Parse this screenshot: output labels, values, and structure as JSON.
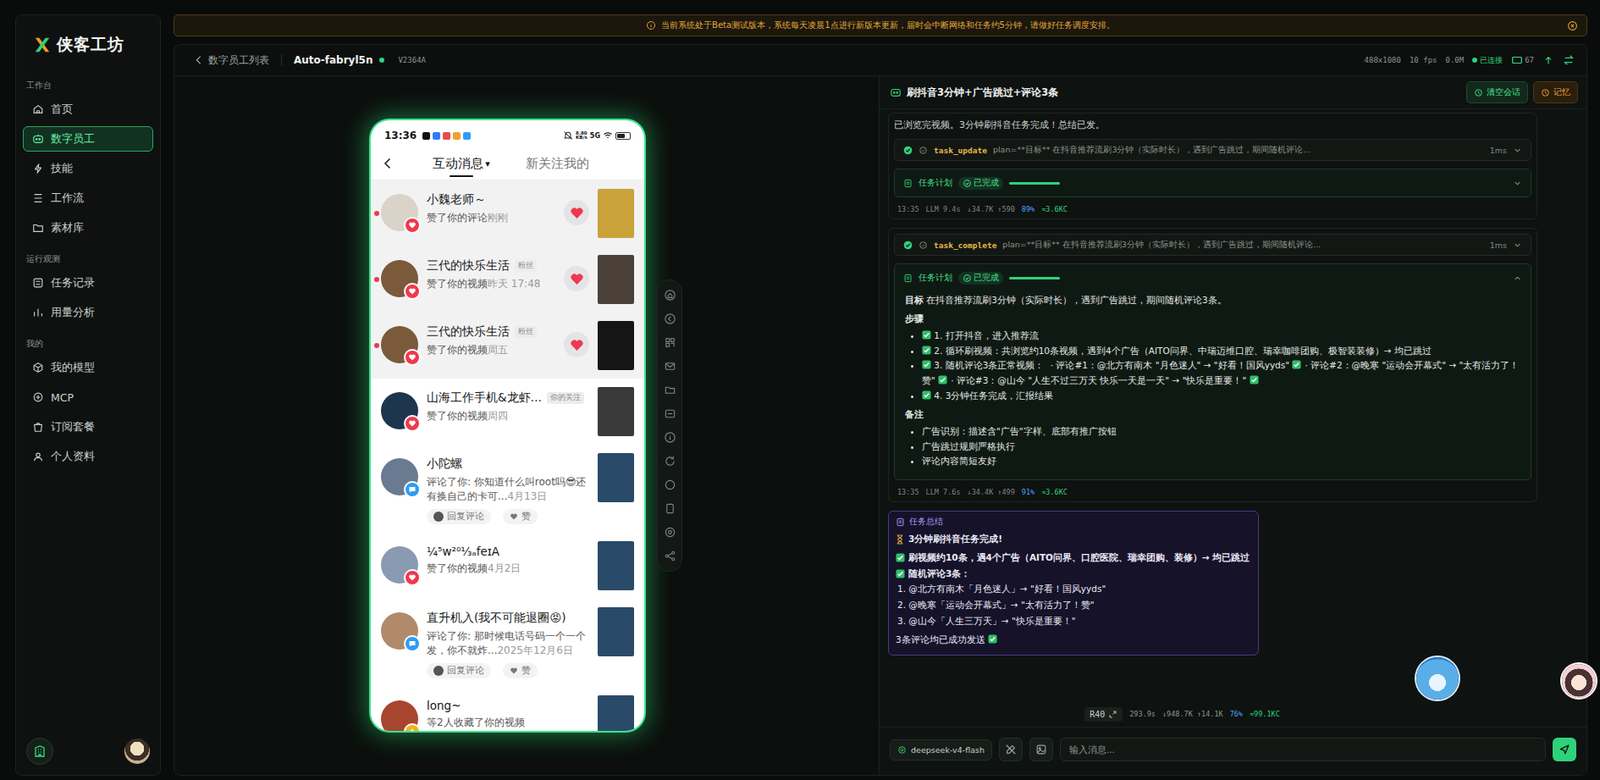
{
  "sidebar": {
    "logo": "侠客工坊",
    "sections": [
      {
        "title": "工作台",
        "items": [
          {
            "label": "首页",
            "selected": false
          },
          {
            "label": "数字员工",
            "selected": true
          },
          {
            "label": "技能",
            "selected": false
          },
          {
            "label": "工作流",
            "selected": false
          },
          {
            "label": "素材库",
            "selected": false
          }
        ]
      },
      {
        "title": "运行观测",
        "items": [
          {
            "label": "任务记录",
            "selected": false
          },
          {
            "label": "用量分析",
            "selected": false
          }
        ]
      },
      {
        "title": "我的",
        "items": [
          {
            "label": "我的模型",
            "selected": false
          },
          {
            "label": "MCP",
            "selected": false
          },
          {
            "label": "订阅套餐",
            "selected": false
          },
          {
            "label": "个人资料",
            "selected": false
          }
        ]
      }
    ]
  },
  "banner": {
    "text": "当前系统处于Beta测试版本，系统每天凌晨1点进行新版本更新，届时会中断网络和任务约5分钟，请做好任务调度安排。"
  },
  "header": {
    "back": "数字员工列表",
    "name": "Auto-fabryl5n",
    "online": true,
    "version": "V2364A",
    "resolution": "488x1080",
    "fps": "10 fps",
    "bitrate": "0.0M",
    "connection": "已连接",
    "connected": true,
    "count": "67"
  },
  "phone": {
    "status": {
      "time": "13:36",
      "apps": [
        {
          "color": "#111111"
        },
        {
          "color": "#2f7cf6"
        },
        {
          "color": "#e84b4b"
        },
        {
          "color": "#f0a030"
        },
        {
          "color": "#2f9cf6"
        }
      ],
      "speed": "8.80",
      "speed_unit": "KB/s",
      "network": "5G",
      "battery": 0.65
    },
    "tabs": [
      {
        "label": "互动消息",
        "selected": true,
        "caret": "▾"
      },
      {
        "label": "新关注我的",
        "selected": false
      }
    ],
    "rows": [
      {
        "name": "小魏老师～",
        "text": "赞了你的评论",
        "time": "刚刚",
        "unread": true,
        "liked": true,
        "badge": "like",
        "avatar_color": "#d9d3ca",
        "thumb_color": "#c9a23a"
      },
      {
        "name": "三代的快乐生活",
        "tag": "粉丝",
        "text": "赞了你的视频",
        "time": "昨天 17:48",
        "unread": true,
        "liked": true,
        "badge": "like",
        "avatar_color": "#7a5a3a",
        "thumb_color": "#4a4038"
      },
      {
        "name": "三代的快乐生活",
        "tag": "粉丝",
        "text": "赞了你的视频",
        "time": "周五",
        "unread": true,
        "liked": true,
        "badge": "like",
        "avatar_color": "#7a5a3a",
        "thumb_color": "#151515"
      },
      {
        "name": "山海工作手机&龙虾…",
        "tag": "你的关注",
        "text": "赞了你的视频",
        "time": "周四",
        "unread": false,
        "liked": false,
        "badge": "like",
        "avatar_color": "#1e3550",
        "thumb_color": "#3a3a3a"
      },
      {
        "name": "小陀螺",
        "text": "评论了你: 你知道什么叫root吗😎还有换自己的卡可...",
        "time": "4月13日",
        "unread": false,
        "liked": false,
        "badge": "comment",
        "avatar_color": "#6a7a90",
        "thumb_color": "#2a4a6a",
        "actions": [
          "回复评论",
          "赞"
        ]
      },
      {
        "name": "¼⁵w²⁰¹⁄₃ₐfeɪA",
        "text": "赞了你的视频",
        "time": "4月2日",
        "unread": false,
        "liked": false,
        "badge": "like",
        "avatar_color": "#8a9ab0",
        "thumb_color": "#2a4a6a"
      },
      {
        "name": "直升机入(我不可能退圈😡)",
        "text": "评论了你: 那时候电话号码一个一个发，你不就炸...",
        "time": "2025年12月6日",
        "unread": false,
        "liked": false,
        "badge": "comment",
        "avatar_color": "#b08a6a",
        "thumb_color": "#2a4a6a",
        "actions": [
          "回复评论",
          "赞"
        ]
      },
      {
        "name": "long~",
        "text": "等2人收藏了你的视频",
        "unread": false,
        "liked": false,
        "badge": "collect",
        "avatar_color": "#a8452e",
        "thumb_color": "#2a4a6a"
      }
    ]
  },
  "chat": {
    "title": "刷抖音3分钟+广告跳过+评论3条",
    "buttons": [
      {
        "label": "清空会话",
        "kind": "clear"
      },
      {
        "label": "记忆",
        "kind": "memory"
      }
    ],
    "groups": [
      {
        "intro": "已浏览完视频。3分钟刷抖音任务完成！总结已发。",
        "tools": [
          {
            "name": "task_update",
            "args": "plan=**目标** 在抖音推荐流刷3分钟（实际时长），遇到广告跳过，期间随机评论...",
            "duration": "1ms",
            "done": true
          }
        ],
        "plan": {
          "title": "任务计划",
          "status": "已完成",
          "level": 1,
          "expanded": false
        },
        "meta": {
          "time": "13:35",
          "llm": "LLM 9.4s",
          "tokens": "↓34.7K ↑590",
          "pct": "89%",
          "cost": "≈3.6KC"
        }
      },
      {
        "tools": [
          {
            "name": "task_complete",
            "args": "plan=**目标** 在抖音推荐流刷3分钟（实际时长），遇到广告跳过，期间随机评论...",
            "duration": "1ms",
            "done": true
          }
        ],
        "plan": {
          "title": "任务计划",
          "status": "已完成",
          "level": 1,
          "expanded": true,
          "goal_label": "目标",
          "goal": "在抖音推荐流刷3分钟（实际时长），遇到广告跳过，期间随机评论3条。",
          "steps_label": "步骤",
          "steps": [
            {
              "text": "1. 打开抖音，进入推荐流",
              "checked": true,
              "parts": []
            },
            {
              "text": "2. 循环刷视频：共浏览约10条视频，遇到4个广告（AITO问界、中瑞迈维口腔、瑞幸咖啡团购、极智装装修）→ 均已跳过",
              "checked": true,
              "parts": []
            },
            {
              "text": "3. 随机评论3条正常视频：",
              "checked": true,
              "parts": [
                {
                  "text": "· 评论#1：@北方有南木 \"月色迷人\" → \"好看！国风yyds\"",
                  "done": true
                },
                {
                  "text": "· 评论#2：@晚寒 \"运动会开幕式\" → \"太有活力了！赞\"",
                  "done": true
                },
                {
                  "text": "· 评论#3：@山今 \"人生不过三万天 快乐一天是一天\" → \"快乐是重要！\"",
                  "done": true
                }
              ]
            },
            {
              "text": "4. 3分钟任务完成，汇报结果",
              "checked": true,
              "parts": []
            }
          ],
          "notes_label": "备注",
          "notes": [
            "广告识别：描述含\"广告\"字样、底部有推广按钮",
            "广告跳过规则严格执行",
            "评论内容简短友好"
          ]
        },
        "meta": {
          "time": "13:35",
          "llm": "LLM 7.6s",
          "tokens": "↓34.4K ↑499",
          "pct": "91%",
          "cost": "≈3.6KC"
        }
      }
    ],
    "summary": {
      "label": "任务总结",
      "title": "3分钟刷抖音任务完成!",
      "lines": [
        {
          "text": "刷视频约10条，遇4个广告（AITO问界、口腔医院、瑞幸团购、装修）→ 均已跳过",
          "check": true
        },
        {
          "text": "随机评论3条：",
          "check": true
        }
      ],
      "list": [
        "1. @北方有南木「月色迷人」→ \"好看！国风yyds\"",
        "2. @晚寒「运动会开幕式」→ \"太有活力了！赞\"",
        "3. @山今「人生三万天」→ \"快乐是重要！\""
      ],
      "footer": "3条评论均已成功发送",
      "footer_check": true
    },
    "footer": {
      "round": "R40",
      "duration": "293.9s",
      "tokens": "↓948.7K ↑14.1K",
      "pct": "76%",
      "cost": "≈99.1KC"
    },
    "input": {
      "model": "deepseek-v4-flash",
      "placeholder": "输入消息..."
    }
  }
}
